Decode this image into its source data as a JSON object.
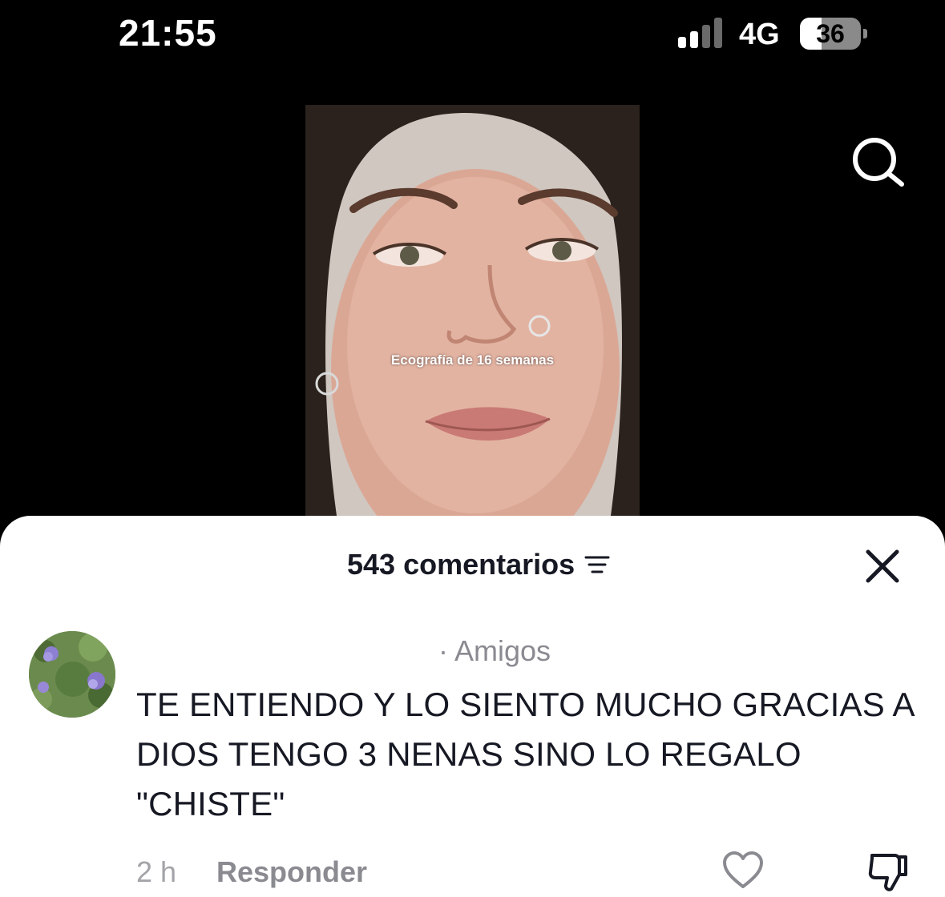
{
  "status_bar": {
    "time": "21:55",
    "network": "4G",
    "battery": "36",
    "battery_level": 0.36,
    "signal_bars_active": 2
  },
  "video": {
    "caption": "Ecografía de 16 semanas"
  },
  "icons": {
    "search": "search-icon",
    "filter": "filter-icon",
    "close": "close-icon",
    "like": "heart-icon",
    "dislike": "thumbs-down-icon"
  },
  "comments_sheet": {
    "title": "543 comentarios",
    "comments": [
      {
        "badge": "· Amigos",
        "text": "TE ENTIENDO Y LO SIENTO MUCHO GRACIAS A DIOS TENGO 3 NENAS SINO LO REGALO \"CHISTE\"",
        "time": "2 h",
        "reply_label": "Responder"
      }
    ]
  },
  "colors": {
    "text_primary": "#161823",
    "text_secondary": "#8a8b91",
    "sheet_bg": "#ffffff",
    "screen_bg": "#000000"
  }
}
